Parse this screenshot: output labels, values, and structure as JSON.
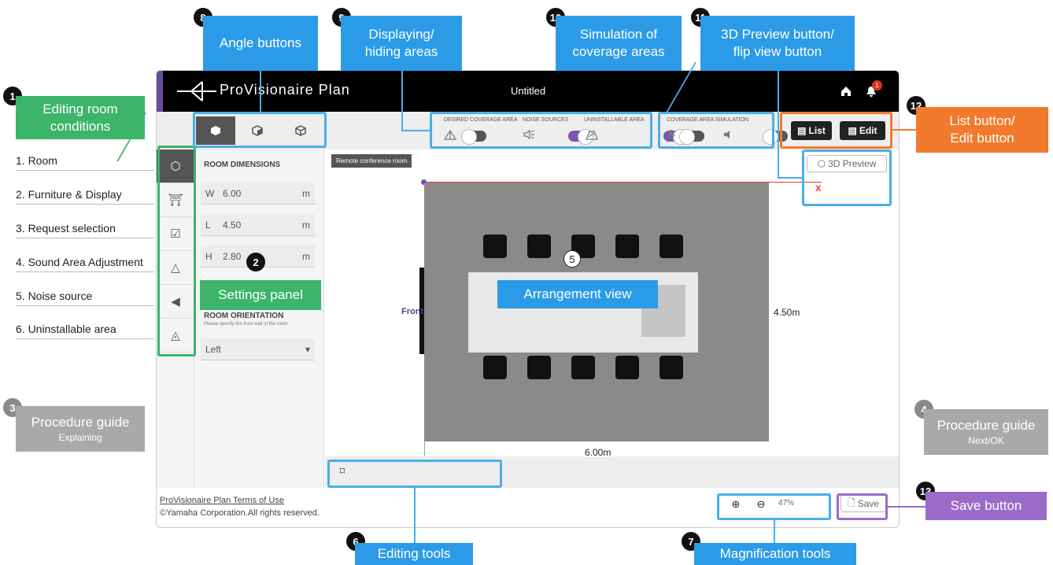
{
  "app": {
    "logo": "ProVisionaire Plan",
    "title": "Untitled",
    "notification_count": "1",
    "room_tag": "Remote conference room",
    "settings": {
      "section_title": "ROOM DIMENSIONS",
      "w_label": "W",
      "w_value": "6.00",
      "w_unit": "m",
      "l_label": "L",
      "l_value": "4.50",
      "l_unit": "m",
      "h_label": "H",
      "h_value": "2.80",
      "h_unit": "m",
      "orientation_title": "ROOM ORIENTATION",
      "orientation_hint": "Please specify the front wall of the room",
      "orientation_value": "Left"
    },
    "toolbar": {
      "desired_coverage": "DESIRED COVERAGE AREA",
      "noise_sources": "NOISE SOURCES",
      "uninstallable": "UNINSTALLABLE AREA",
      "coverage_sim": "COVERAGE AREA SIMULATION",
      "list_btn": "List",
      "edit_btn": "Edit",
      "preview_btn": "3D Preview"
    },
    "canvas": {
      "width_label": "6.00m",
      "length_label": "4.50m",
      "front_label": "Front",
      "x_axis": "X"
    },
    "footer": {
      "terms": "ProVisionaire Plan Terms of Use",
      "copyright": "©Yamaha Corporation.All rights reserved.",
      "zoom": "47%",
      "save": "Save"
    }
  },
  "callouts": {
    "c1": {
      "num": "1",
      "line1": "Editing room",
      "line2": "conditions"
    },
    "c2": {
      "num": "2",
      "text": "Settings panel"
    },
    "c3": {
      "num": "3",
      "line1": "Procedure guide",
      "line2": "Explaining"
    },
    "c4": {
      "num": "4",
      "line1": "Procedure guide",
      "line2": "Next/OK"
    },
    "c5": {
      "num": "5",
      "text": "Arrangement view"
    },
    "c6": {
      "num": "6",
      "text": "Editing tools"
    },
    "c7": {
      "num": "7",
      "text": "Magnification tools"
    },
    "c8": {
      "num": "8",
      "text": "Angle buttons"
    },
    "c9": {
      "num": "9",
      "line1": "Displaying/",
      "line2": "hiding areas"
    },
    "c10": {
      "num": "10",
      "line1": "Simulation of",
      "line2": "coverage areas"
    },
    "c11": {
      "num": "11",
      "line1": "3D Preview button/",
      "line2": "flip view button"
    },
    "c12": {
      "num": "12",
      "line1": "List button/",
      "line2": "Edit button"
    },
    "c13": {
      "num": "13",
      "text": "Save button"
    }
  },
  "room_list": [
    "1. Room",
    "2. Furniture & Display",
    "3. Request selection",
    "4. Sound Area Adjustment",
    "5. Noise source",
    "6. Uninstallable area"
  ]
}
